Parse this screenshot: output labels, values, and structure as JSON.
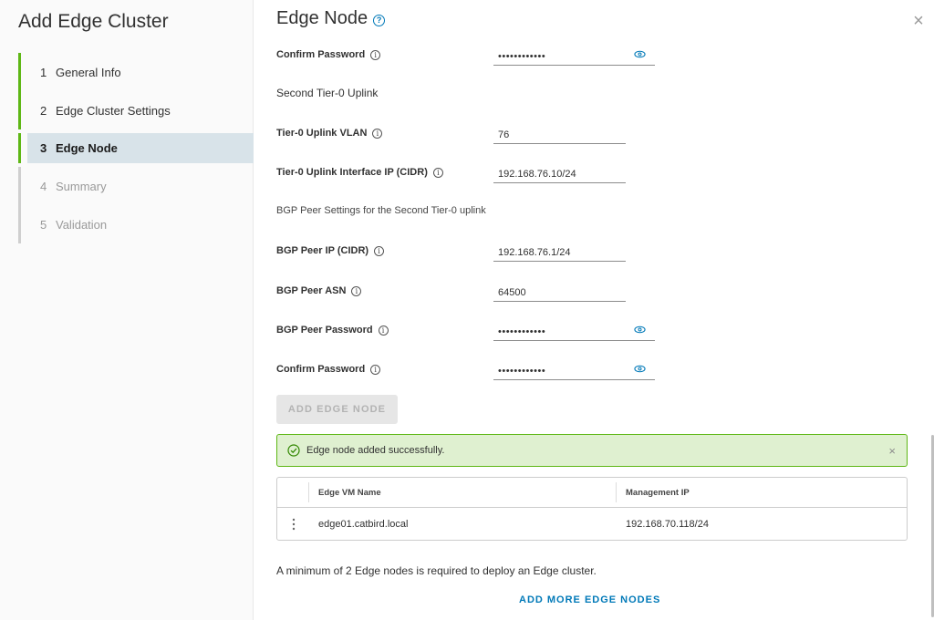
{
  "wizard": {
    "title": "Add Edge Cluster",
    "steps": [
      {
        "num": "1",
        "label": "General Info",
        "state": "done"
      },
      {
        "num": "2",
        "label": "Edge Cluster Settings",
        "state": "done"
      },
      {
        "num": "3",
        "label": "Edge Node",
        "state": "active"
      },
      {
        "num": "4",
        "label": "Summary",
        "state": "todo"
      },
      {
        "num": "5",
        "label": "Validation",
        "state": "todo"
      }
    ]
  },
  "main": {
    "title": "Edge Node",
    "help_icon": "?",
    "close_icon": "×",
    "fields": {
      "confirm_password_1": {
        "label": "Confirm Password",
        "value": "••••••••••••"
      },
      "tier0_vlan": {
        "label": "Tier-0 Uplink VLAN",
        "value": "76"
      },
      "tier0_ip": {
        "label": "Tier-0 Uplink Interface IP (CIDR)",
        "value": "192.168.76.10/24"
      },
      "bgp_peer_ip": {
        "label": "BGP Peer IP (CIDR)",
        "value": "192.168.76.1/24"
      },
      "bgp_peer_asn": {
        "label": "BGP Peer ASN",
        "value": "64500"
      },
      "bgp_peer_password": {
        "label": "BGP Peer Password",
        "value": "••••••••••••"
      },
      "confirm_password_2": {
        "label": "Confirm Password",
        "value": "••••••••••••"
      }
    },
    "section_second_uplink": "Second Tier-0 Uplink",
    "section_bgp": "BGP Peer Settings for the Second Tier-0 uplink",
    "add_edge_node_button": "ADD EDGE NODE",
    "alert": {
      "message": "Edge node added successfully.",
      "close": "×"
    },
    "grid": {
      "headers": [
        "Edge VM Name",
        "Management IP"
      ],
      "rows": [
        {
          "name": "edge01.catbird.local",
          "ip": "192.168.70.118/24"
        }
      ]
    },
    "note": "A minimum of 2 Edge nodes is required to deploy an Edge cluster.",
    "add_more_link": "ADD MORE EDGE NODES"
  },
  "colors": {
    "accent": "#0079b8",
    "success": "#5eb715",
    "active_step_bg": "#d8e3e9"
  }
}
